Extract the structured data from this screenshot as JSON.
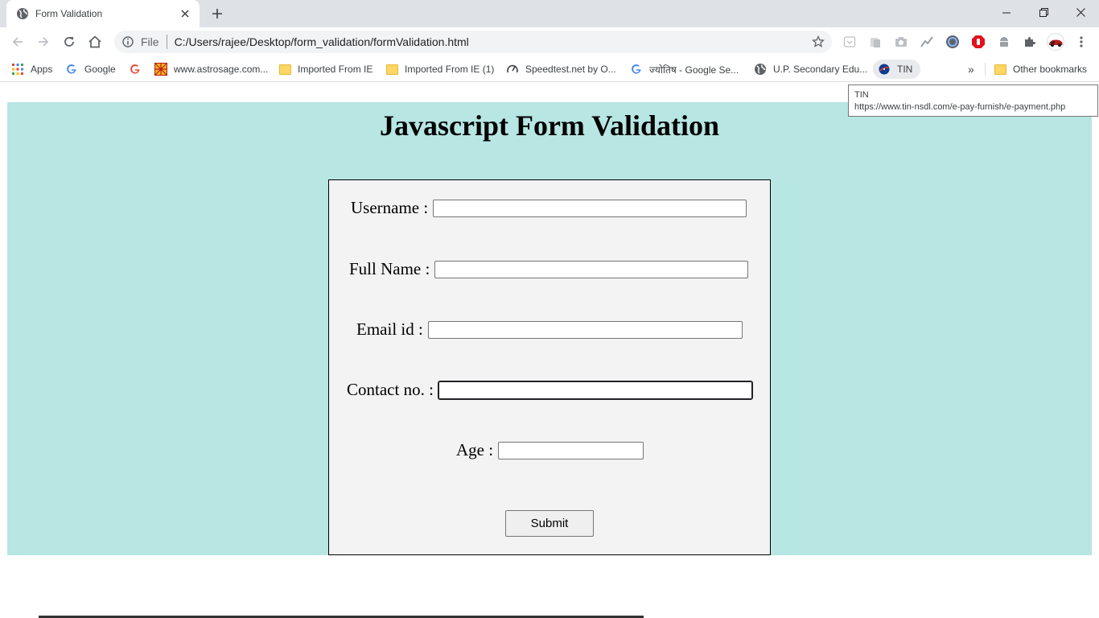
{
  "browser": {
    "tab_title": "Form Validation",
    "tab_icon": "globe-icon",
    "address": {
      "scheme_label": "File",
      "url": "C:/Users/rajee/Desktop/form_validation/formValidation.html"
    },
    "bookmarks": [
      {
        "label": "Apps",
        "icon": "apps-grid-icon"
      },
      {
        "label": "Google",
        "icon": "google-icon"
      },
      {
        "label": "",
        "icon": "google-icon"
      },
      {
        "label": "www.astrosage.com...",
        "icon": "astrosage-icon"
      },
      {
        "label": "Imported From IE",
        "icon": "folder-icon"
      },
      {
        "label": "Imported From IE (1)",
        "icon": "folder-icon"
      },
      {
        "label": "Speedtest.net by O...",
        "icon": "speedometer-icon"
      },
      {
        "label": "ज्योतिष - Google Se...",
        "icon": "google-icon"
      },
      {
        "label": "U.P. Secondary Edu...",
        "icon": "globe-icon"
      },
      {
        "label": "TIN",
        "icon": "nasa-icon"
      }
    ],
    "more_bookmarks": "»",
    "other_bookmarks": "Other bookmarks",
    "tooltip": {
      "title": "TIN",
      "url": "https://www.tin-nsdl.com/e-pay-furnish/e-payment.php"
    }
  },
  "page": {
    "heading": "Javascript Form Validation",
    "fields": {
      "username": {
        "label": "Username :",
        "value": ""
      },
      "fullname": {
        "label": "Full Name :",
        "value": ""
      },
      "email": {
        "label": "Email id :",
        "value": ""
      },
      "contact": {
        "label": "Contact no. :",
        "value": ""
      },
      "age": {
        "label": "Age :",
        "value": ""
      }
    },
    "submit_label": "Submit",
    "colors": {
      "page_bg": "#b7e6e3",
      "form_bg": "#f3f3f3"
    }
  }
}
